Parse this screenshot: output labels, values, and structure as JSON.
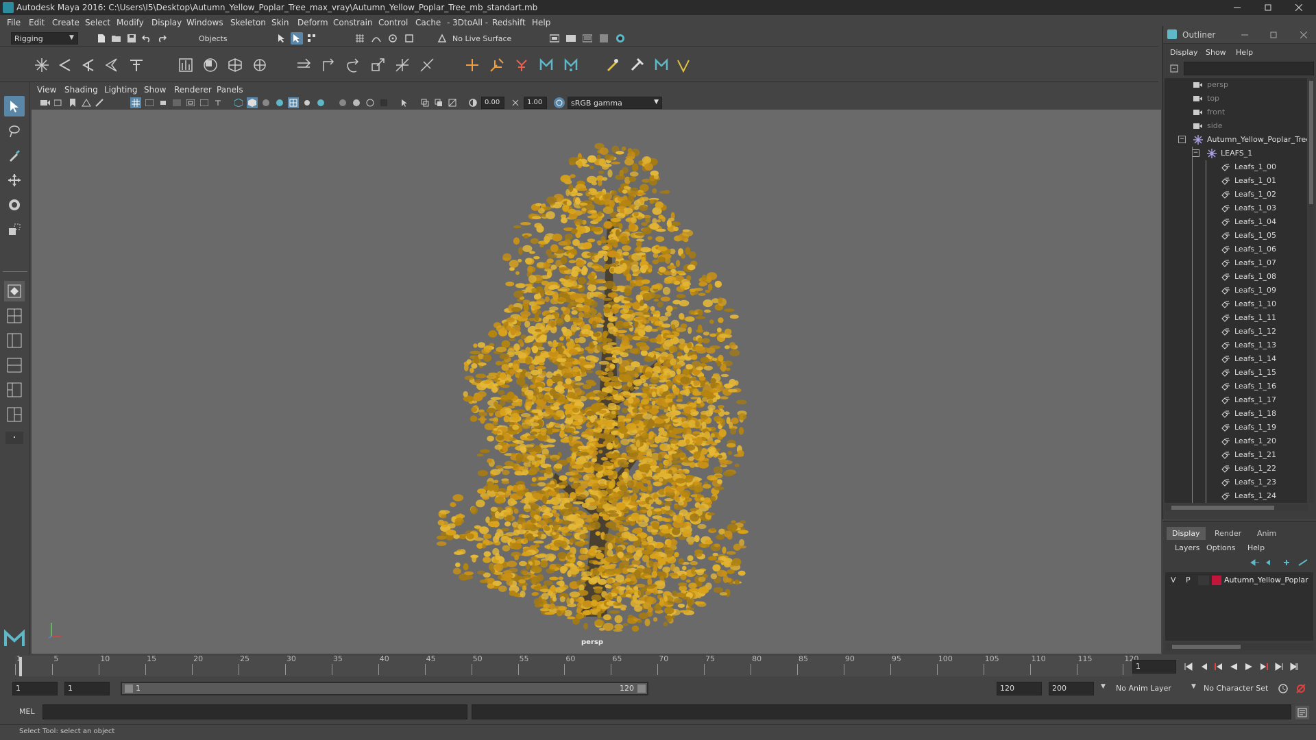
{
  "window": {
    "title": "Autodesk Maya 2016: C:\\Users\\I5\\Desktop\\Autumn_Yellow_Poplar_Tree_max_vray\\Autumn_Yellow_Poplar_Tree_mb_standart.mb",
    "accent": "#5fb8c8"
  },
  "menubar": {
    "items": [
      "File",
      "Edit",
      "Create",
      "Select",
      "Modify",
      "Display",
      "Windows",
      "Skeleton",
      "Skin",
      "Deform",
      "Constrain",
      "Control",
      "Cache",
      "- 3DtoAll -",
      "Redshift",
      "Help"
    ]
  },
  "statusline": {
    "mode": "Rigging",
    "selection_mask": "Objects",
    "live_surface": "No Live Surface"
  },
  "panel": {
    "menus": [
      "View",
      "Shading",
      "Lighting",
      "Show",
      "Renderer",
      "Panels"
    ],
    "exposure": "0.00",
    "gamma": "1.00",
    "color_space": "sRGB gamma",
    "camera_label": "persp",
    "tree_color": "#d9a21a"
  },
  "outliner": {
    "title": "Outliner",
    "menus": [
      "Display",
      "Show",
      "Help"
    ],
    "cameras": [
      "persp",
      "top",
      "front",
      "side"
    ],
    "root": "Autumn_Yellow_Poplar_Tree_",
    "group": "LEAFS_1",
    "items": [
      "Leafs_1_00",
      "Leafs_1_01",
      "Leafs_1_02",
      "Leafs_1_03",
      "Leafs_1_04",
      "Leafs_1_05",
      "Leafs_1_06",
      "Leafs_1_07",
      "Leafs_1_08",
      "Leafs_1_09",
      "Leafs_1_10",
      "Leafs_1_11",
      "Leafs_1_12",
      "Leafs_1_13",
      "Leafs_1_14",
      "Leafs_1_15",
      "Leafs_1_16",
      "Leafs_1_17",
      "Leafs_1_18",
      "Leafs_1_19",
      "Leafs_1_20",
      "Leafs_1_21",
      "Leafs_1_22",
      "Leafs_1_23",
      "Leafs_1_24"
    ]
  },
  "layers": {
    "tabs": [
      "Display",
      "Render",
      "Anim"
    ],
    "menus": [
      "Layers",
      "Options",
      "Help"
    ],
    "layer": {
      "v": "V",
      "p": "P",
      "name": "Autumn_Yellow_Poplar",
      "color": "#c0163a"
    }
  },
  "timeline": {
    "ticks": [
      "1",
      "5",
      "10",
      "15",
      "20",
      "25",
      "30",
      "35",
      "40",
      "45",
      "50",
      "55",
      "60",
      "65",
      "70",
      "75",
      "80",
      "85",
      "90",
      "95",
      "100",
      "105",
      "110",
      "115",
      "120"
    ],
    "current_frame": "1"
  },
  "range": {
    "start": "1",
    "start2": "1",
    "range_start": "1",
    "range_end": "120",
    "end": "120",
    "end2": "200",
    "anim_layer": "No Anim Layer",
    "char_set": "No Character Set"
  },
  "cmdline": {
    "lang": "MEL"
  },
  "helpline": {
    "text": "Select Tool: select an object"
  }
}
